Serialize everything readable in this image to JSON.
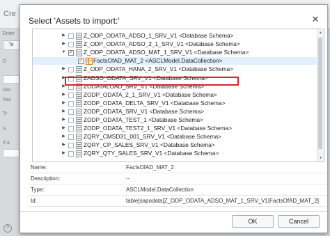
{
  "background": {
    "title": "Cre",
    "labels": [
      "Enter",
      "D",
      "Ass",
      "Ass",
      "Tr",
      "S",
      "If a"
    ],
    "tab_label": "Te",
    "help_label": "?"
  },
  "dialog": {
    "title": "Select 'Assets to import:'",
    "close_label": "✕"
  },
  "tree": {
    "rows": [
      {
        "expander": "▶",
        "checked": false,
        "icon": "schema-icon",
        "label": "Z_ODP_ODATA_ADSO_1_SRV_V1 <Database Schema>"
      },
      {
        "expander": "▶",
        "checked": false,
        "icon": "schema-icon",
        "label": "Z_ODP_ODATA_ADSO_2_1_SRV_V1 <Database Schema>"
      },
      {
        "expander": "▼",
        "checked": true,
        "icon": "schema-icon",
        "label": "Z_ODP_ODATA_ADSO_MAT_1_SRV_V1 <Database Schema>",
        "highlighted": true
      },
      {
        "expander": "",
        "checked": true,
        "icon": "datacollection-icon",
        "label": "FactsOfAD_MAT_2 <ASCLModel.DataCollection>",
        "selected": true
      },
      {
        "expander": "▶",
        "checked": false,
        "icon": "schema-icon",
        "label": "Z_ODP_ODATA_HANA_2_SRV_V1 <Database Schema>"
      },
      {
        "expander": "▶",
        "checked": false,
        "icon": "schema-icon",
        "label": "ZADSO_ODATA_SRV_V1 <Database Schema>"
      },
      {
        "expander": "▶",
        "checked": false,
        "icon": "schema-icon",
        "label": "ZODATALOAD_SRV_V1 <Database Schema>"
      },
      {
        "expander": "▶",
        "checked": false,
        "icon": "schema-icon",
        "label": "ZODP_ODATA_2_1_SRV_V1 <Database Schema>"
      },
      {
        "expander": "▶",
        "checked": false,
        "icon": "schema-icon",
        "label": "ZODP_ODATA_DELTA_SRV_V1 <Database Schema>"
      },
      {
        "expander": "▶",
        "checked": false,
        "icon": "schema-icon",
        "label": "ZODP_ODATA_SRV_V1 <Database Schema>"
      },
      {
        "expander": "▶",
        "checked": false,
        "icon": "schema-icon",
        "label": "ZODP_ODATA_TEST_1 <Database Schema>"
      },
      {
        "expander": "▶",
        "checked": false,
        "icon": "schema-icon",
        "label": "ZODP_ODATA_TEST2_1_SRV_V1 <Database Schema>"
      },
      {
        "expander": "▶",
        "checked": false,
        "icon": "schema-icon",
        "label": "ZQRY_CMSD31_001_SRV_V1 <Database Schema>"
      },
      {
        "expander": "▶",
        "checked": false,
        "icon": "schema-icon",
        "label": "ZQRY_CP_SALES_SRV_V1 <Database Schema>"
      },
      {
        "expander": "▶",
        "checked": false,
        "icon": "schema-icon",
        "label": "ZQRY_QTY_SALES_SRV_V1 <Database Schema>"
      }
    ]
  },
  "properties": [
    {
      "key": "Name:",
      "value": "FactsOfAD_MAT_2"
    },
    {
      "key": "Description:",
      "value": "--"
    },
    {
      "key": "Type:",
      "value": "ASCLModel.DataCollection"
    },
    {
      "key": "Id:",
      "value": "table[sapodata[Z_ODP_ODATA_ADSO_MAT_1_SRV_V1|FactsOfAD_MAT_2]"
    }
  ],
  "buttons": {
    "ok_label": "OK",
    "cancel_label": "Cancel"
  },
  "colors": {
    "highlight_border": "#d9232d",
    "selected_row": "#e1efff"
  }
}
